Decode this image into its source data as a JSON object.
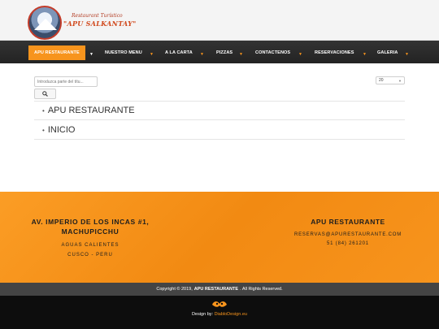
{
  "header": {
    "logo_tagline": "Restaurant Turístico",
    "logo_name": "\"APU SALKANTAY\""
  },
  "nav": {
    "items": [
      {
        "label": "APU RESTAURANTE",
        "active": true
      },
      {
        "label": "NUESTRO MENU",
        "active": false
      },
      {
        "label": "A LA CARTA",
        "active": false
      },
      {
        "label": "PIZZAS",
        "active": false
      },
      {
        "label": "CONTACTENOS",
        "active": false
      },
      {
        "label": "RESERVACIONES",
        "active": false
      },
      {
        "label": "GALERIA",
        "active": false
      }
    ],
    "caret": "▼"
  },
  "content": {
    "search_placeholder": "Introduzca parte del títu...",
    "search_icon": "search-icon",
    "limit_value": "20",
    "list": [
      "APU RESTAURANTE",
      "INICIO"
    ]
  },
  "footer": {
    "address_line1": "AV. IMPERIO DE LOS INCAS #1,",
    "address_line2": "MACHUPICCHU",
    "city": "AGUAS CALIENTES",
    "region": "CUSCO - PERU",
    "restaurant_title": "APU RESTAURANTE",
    "email": "RESERVAS@APURESTAURANTE.COM",
    "phone": "51 (84) 261201"
  },
  "copyright": {
    "prefix": "Copyright © 2019,",
    "brand": "APU RESTAURANTE",
    "suffix": ". All Rights Reserved."
  },
  "designer": {
    "label": "Design by:",
    "link": "DiabloDesign.eu"
  },
  "colors": {
    "accent": "#f7941d",
    "nav_bg": "#2b2b2b",
    "copy_bg": "#444444",
    "design_bg": "#0d0d0d"
  }
}
